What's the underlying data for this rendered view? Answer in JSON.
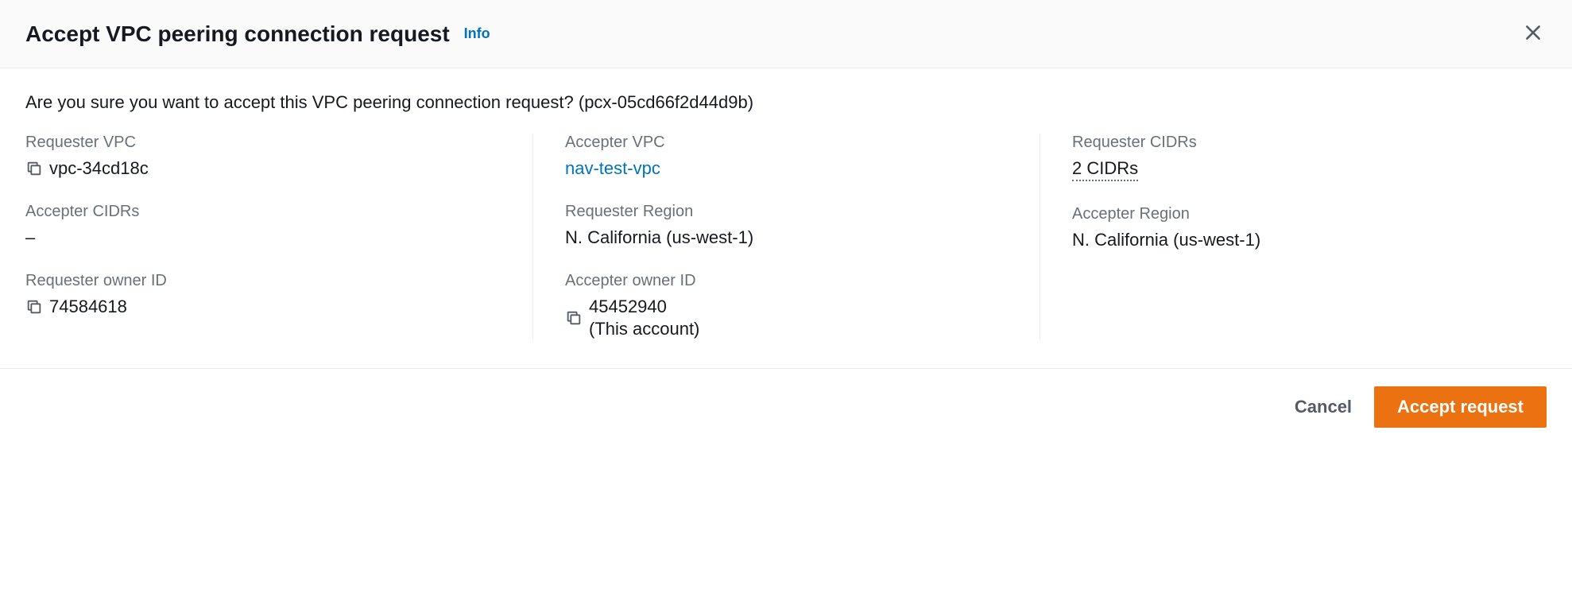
{
  "header": {
    "title": "Accept VPC peering connection request",
    "info_link": "Info"
  },
  "body": {
    "confirm_prefix": "Are you sure you want to accept this VPC peering connection request? (",
    "pcx_id": "pcx-05cd66f2d44d9b",
    "confirm_suffix": ")"
  },
  "fields": {
    "requester_vpc": {
      "label": "Requester VPC",
      "value": "vpc-34cd18c"
    },
    "accepter_vpc": {
      "label": "Accepter VPC",
      "value": "nav-test-vpc"
    },
    "requester_cidrs": {
      "label": "Requester CIDRs",
      "value": "2 CIDRs"
    },
    "accepter_cidrs": {
      "label": "Accepter CIDRs",
      "value": "–"
    },
    "requester_region": {
      "label": "Requester Region",
      "value": "N. California (us-west-1)"
    },
    "accepter_region": {
      "label": "Accepter Region",
      "value": "N. California (us-west-1)"
    },
    "requester_owner": {
      "label": "Requester owner ID",
      "value": "74584618"
    },
    "accepter_owner": {
      "label": "Accepter owner ID",
      "value": "45452940",
      "note": "(This account)"
    }
  },
  "footer": {
    "cancel": "Cancel",
    "accept": "Accept request"
  }
}
